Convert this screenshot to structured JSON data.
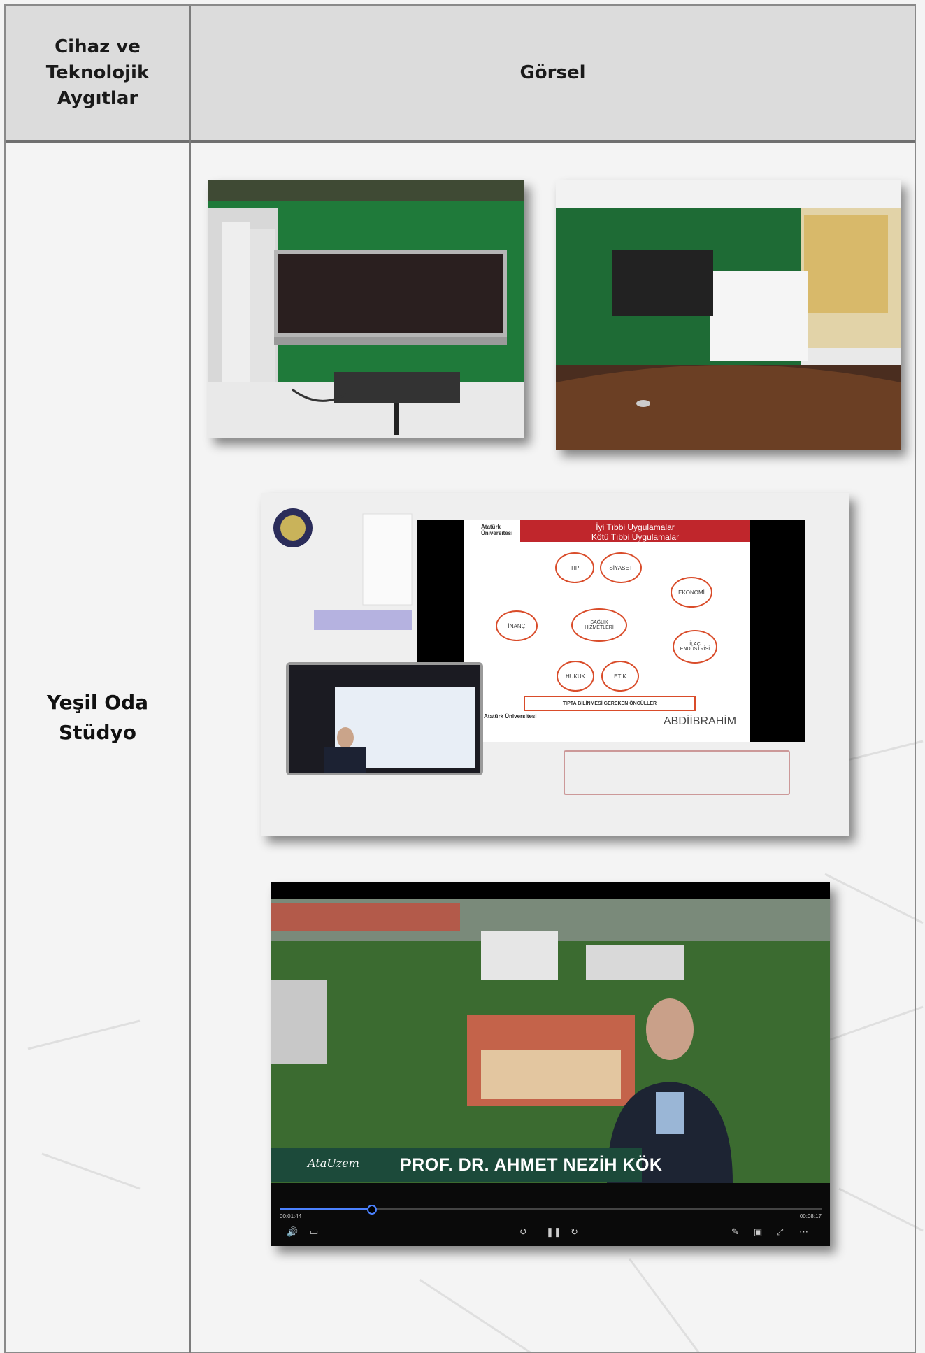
{
  "table": {
    "header": {
      "col1": "Cihaz ve\nTeknolojik\nAygıtlar",
      "col2": "Görsel"
    },
    "row_label": "Yeşil Oda\nStüdyo"
  },
  "slide": {
    "title_line1": "İyi Tıbbi Uygulamalar",
    "title_line2": "Kötü Tıbbi Uygulamalar",
    "university": "Atatürk\nÜniversitesi",
    "nodes": [
      "TIP",
      "SİYASET",
      "EKONOMİ",
      "İNANÇ",
      "SAĞLIK\nHİZMETLERİ",
      "İLAÇ\nENDÜSTRİSİ",
      "HUKUK",
      "ETİK"
    ],
    "bottom_box": "TIPTA BİLİNMESİ GEREKEN ÖNCÜLLER",
    "footer_left": "Atatürk Üniversitesi",
    "sponsor": "ABDİİBRAHİM"
  },
  "video": {
    "name_banner": "PROF. DR. AHMET NEZİH KÖK",
    "brand": "AtaUzem",
    "time_current": "00:01:44",
    "time_total": "00:08:17",
    "progress": 0.17
  }
}
